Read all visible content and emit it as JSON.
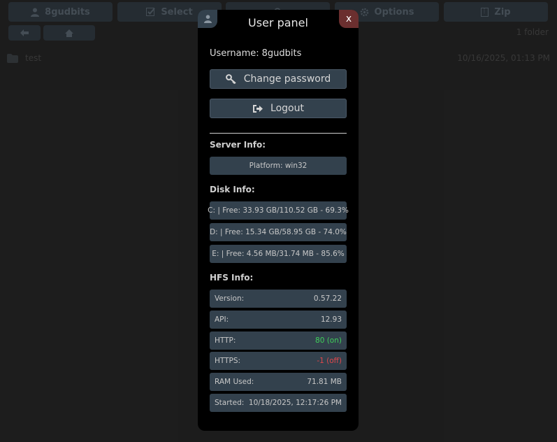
{
  "background": {
    "toolbar": [
      {
        "label": "8gudbits",
        "icon": "user-icon"
      },
      {
        "label": "Select",
        "icon": "check-icon"
      },
      {
        "label": "",
        "icon": "search-icon"
      },
      {
        "label": "Options",
        "icon": "gear-icon"
      },
      {
        "label": "Zip",
        "icon": "zip-icon"
      }
    ],
    "folder_count": "1 folder",
    "file": {
      "name": "test",
      "date": "10/16/2025, 01:13 PM"
    }
  },
  "modal": {
    "title": "User panel",
    "close_label": "x",
    "username_label": "Username:",
    "username": "8gudbits",
    "change_password_label": "Change password",
    "logout_label": "Logout",
    "server_info_label": "Server Info:",
    "platform": "Platform: win32",
    "disk_info_label": "Disk Info:",
    "disks": [
      "C: | Free: 33.93 GB/110.52 GB - 69.3%",
      "D: | Free: 15.34 GB/58.95 GB - 74.0%",
      "E: | Free: 4.56 MB/31.74 MB - 85.6%"
    ],
    "hfs_info_label": "HFS Info:",
    "hfs": [
      {
        "key": "Version:",
        "value": "0.57.22",
        "status": ""
      },
      {
        "key": "API:",
        "value": "12.93",
        "status": ""
      },
      {
        "key": "HTTP:",
        "value": "80 (on)",
        "status": "on"
      },
      {
        "key": "HTTPS:",
        "value": "-1 (off)",
        "status": "off"
      },
      {
        "key": "RAM Used:",
        "value": "71.81 MB",
        "status": ""
      },
      {
        "key": "Started:",
        "value": "10/18/2025, 12:17:26 PM",
        "status": ""
      }
    ]
  },
  "colors": {
    "on": "#3fcf5a",
    "off": "#e0474b",
    "button": "#33414d",
    "close": "#6b2f2f"
  }
}
